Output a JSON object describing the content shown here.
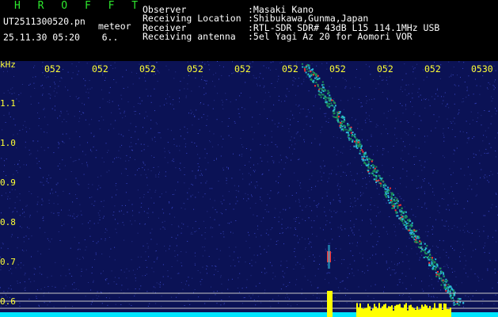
{
  "header": {
    "brand": "H R O F F T",
    "filename": "UT2511300520.pn",
    "filetype": "meteor",
    "datetime": "25.11.30 05:20    6..",
    "meta": [
      {
        "label": "Observer",
        "value": ":Masaki Kano"
      },
      {
        "label": "Receiving Location",
        "value": ":Shibukawa,Gunma,Japan"
      },
      {
        "label": "Receiver",
        "value": ":RTL-SDR SDR# 43dB L15 114.1MHz USB"
      },
      {
        "label": "Receiving antenna",
        "value": ":5el Yagi Az 20 for Aomori VOR"
      }
    ]
  },
  "axes": {
    "unit": "kHz",
    "y_ticks": [
      "1.1",
      "1.0",
      "0.9",
      "0.8",
      "0.7",
      "0.6"
    ],
    "x_ticks": [
      "052",
      "052",
      "052",
      "052",
      "052",
      "052",
      "052",
      "052",
      "052",
      "0530"
    ]
  },
  "colors": {
    "background": "#0b1255",
    "noise": "#3a48c8",
    "trace": "#2bb7d8",
    "hot": "#ff3030",
    "level": "#ffff00",
    "baseline": "#00e5ff",
    "label": "#ffff33"
  }
}
